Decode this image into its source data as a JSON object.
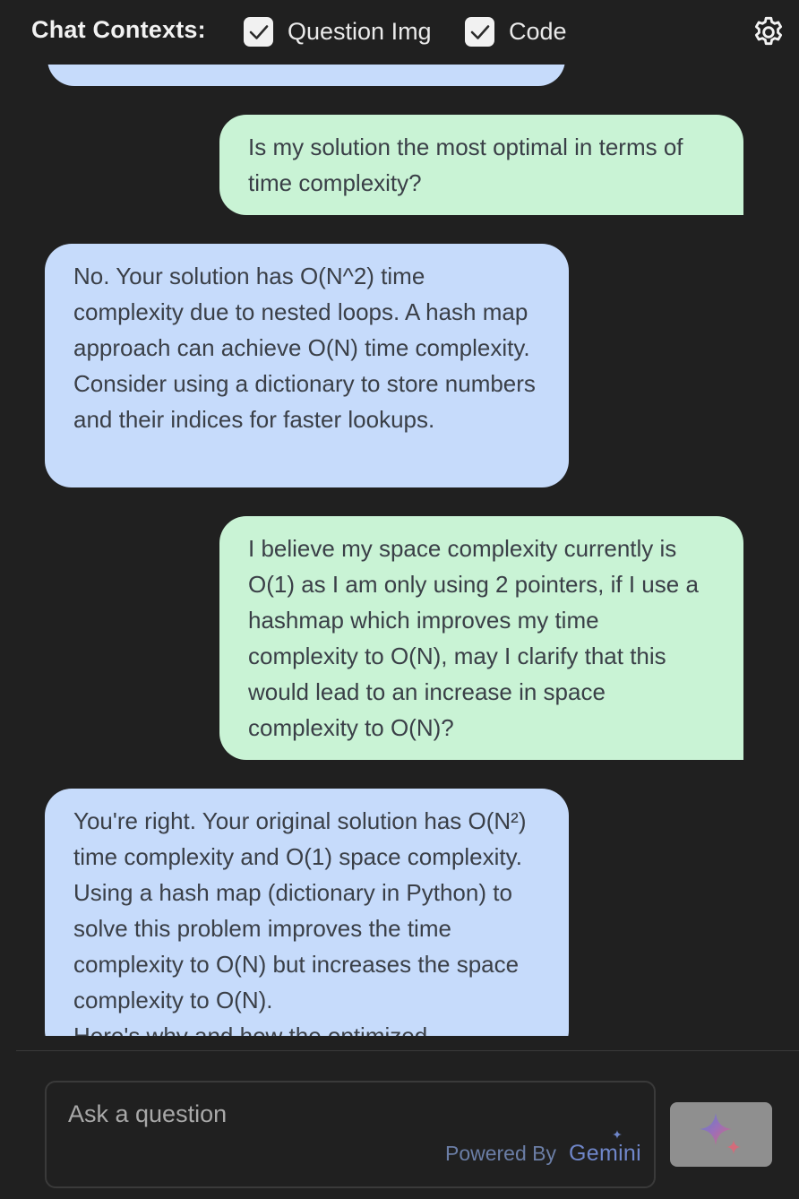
{
  "header": {
    "title": "Chat Contexts:",
    "contexts": [
      {
        "label": "Question Img",
        "checked": true
      },
      {
        "label": "Code",
        "checked": true
      }
    ],
    "settings_icon": "gear-icon"
  },
  "messages": [
    {
      "role": "user",
      "text": "Is my solution the most optimal in terms of time complexity?"
    },
    {
      "role": "assistant",
      "text": "No. Your solution has O(N^2) time complexity due to nested loops. A hash map approach can achieve O(N) time complexity. Consider using a dictionary to store numbers and their indices for faster lookups."
    },
    {
      "role": "user",
      "text": "I believe my space complexity currently is O(1) as I am only using 2 pointers, if I use a hashmap which improves my time complexity to O(N), may I clarify that this would lead to an increase in space complexity to O(N)?"
    },
    {
      "role": "assistant",
      "text": "You're right. Your original solution has O(N²) time complexity and O(1) space complexity. Using a hash map (dictionary in Python) to solve this problem improves the time complexity to O(N) but increases the space complexity to O(N).\nHere's why and how the optimized"
    }
  ],
  "input": {
    "placeholder": "Ask a question",
    "powered_by": "Powered By",
    "brand": "Gemini"
  },
  "send_button": {
    "icon": "gemini-sparkle-icon"
  },
  "colors": {
    "background": "#202020",
    "assistant_bubble": "#c6dbfb",
    "user_bubble": "#c9f3d5",
    "send_button": "#8f8f8f"
  }
}
